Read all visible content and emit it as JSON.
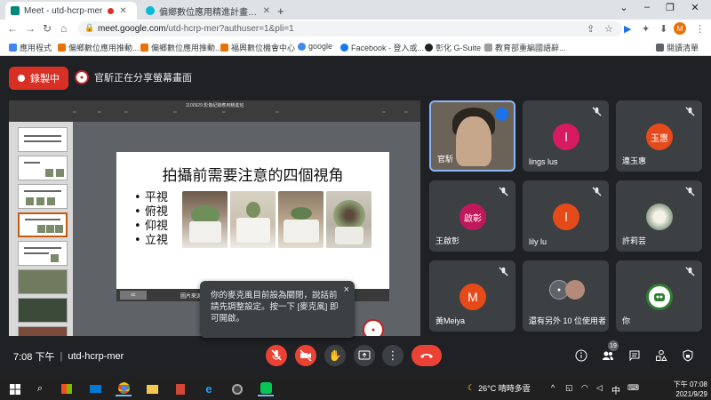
{
  "browser": {
    "tabs": [
      {
        "title": "Meet - utd-hcrp-mer",
        "active": true,
        "recording": true
      },
      {
        "title": "偏鄉數位應用精進計畫-學習中心",
        "active": false
      }
    ],
    "new_tab": "+",
    "url_host": "meet.google.com",
    "url_path": "/utd-hcrp-mer?authuser=1&pli=1",
    "profile_initial": "M",
    "bookmarks": [
      {
        "label": "應用程式",
        "icon_color": "#4285f4"
      },
      {
        "label": "偏鄉數位應用推動...",
        "icon_color": "#e8710a"
      },
      {
        "label": "偏鄉數位應用推動...",
        "icon_color": "#e8710a"
      },
      {
        "label": "福興數位機會中心",
        "icon_color": "#e8710a"
      },
      {
        "label": "google",
        "icon_color": "#4285f4"
      },
      {
        "label": "Facebook - 登入或...",
        "icon_color": "#1877f2"
      },
      {
        "label": "彰化 G-Suite",
        "icon_color": "#202124"
      },
      {
        "label": "教育部重編國語辭...",
        "icon_color": "#9e9e9e"
      }
    ],
    "reading_list": "閱讀清單"
  },
  "meet": {
    "recording_label": "錄製中",
    "presenter_text": "官馸正在分享螢幕畫面",
    "meeting_time": "7:08 下午",
    "meeting_code": "utd-hcrp-mer",
    "participant_count": "19",
    "tooltip": {
      "text": "你的麥克風目前設為關閉，說話前請先調整設定。按一下 [麥克風] 即可開啟。",
      "close": "×"
    },
    "tiles": [
      {
        "name": "官馸",
        "type": "video"
      },
      {
        "name": "lings lus",
        "avatar": "l",
        "color": "#d81b60"
      },
      {
        "name": "連玉惠",
        "avatar": "玉惠",
        "color": "#e64a19"
      },
      {
        "name": "王啟彰",
        "avatar": "啟彰",
        "color": "#c2185b"
      },
      {
        "name": "lily lu",
        "avatar": "l",
        "color": "#e64a19"
      },
      {
        "name": "許莉芸",
        "avatar": "",
        "color": "#8d9e8a"
      },
      {
        "name": "黃Meiya",
        "avatar": "M",
        "color": "#e64a19"
      },
      {
        "name": "還有另外 10 位使用者",
        "type": "others"
      },
      {
        "name": "你",
        "avatar": "",
        "color": "#2e7d32"
      }
    ]
  },
  "slide": {
    "file_title": "1100929 影像紀錄應用精進班",
    "title": "拍攝前需要注意的四個視角",
    "bullets": [
      "平視",
      "俯視",
      "仰視",
      "立視"
    ],
    "footer_label": "圖片來源: 官馸攝影",
    "badge": "官馸"
  },
  "taskbar": {
    "weather": "26°C 晴時多雲",
    "ime": "中",
    "time": "下午 07:08",
    "date": "2021/9/29"
  }
}
